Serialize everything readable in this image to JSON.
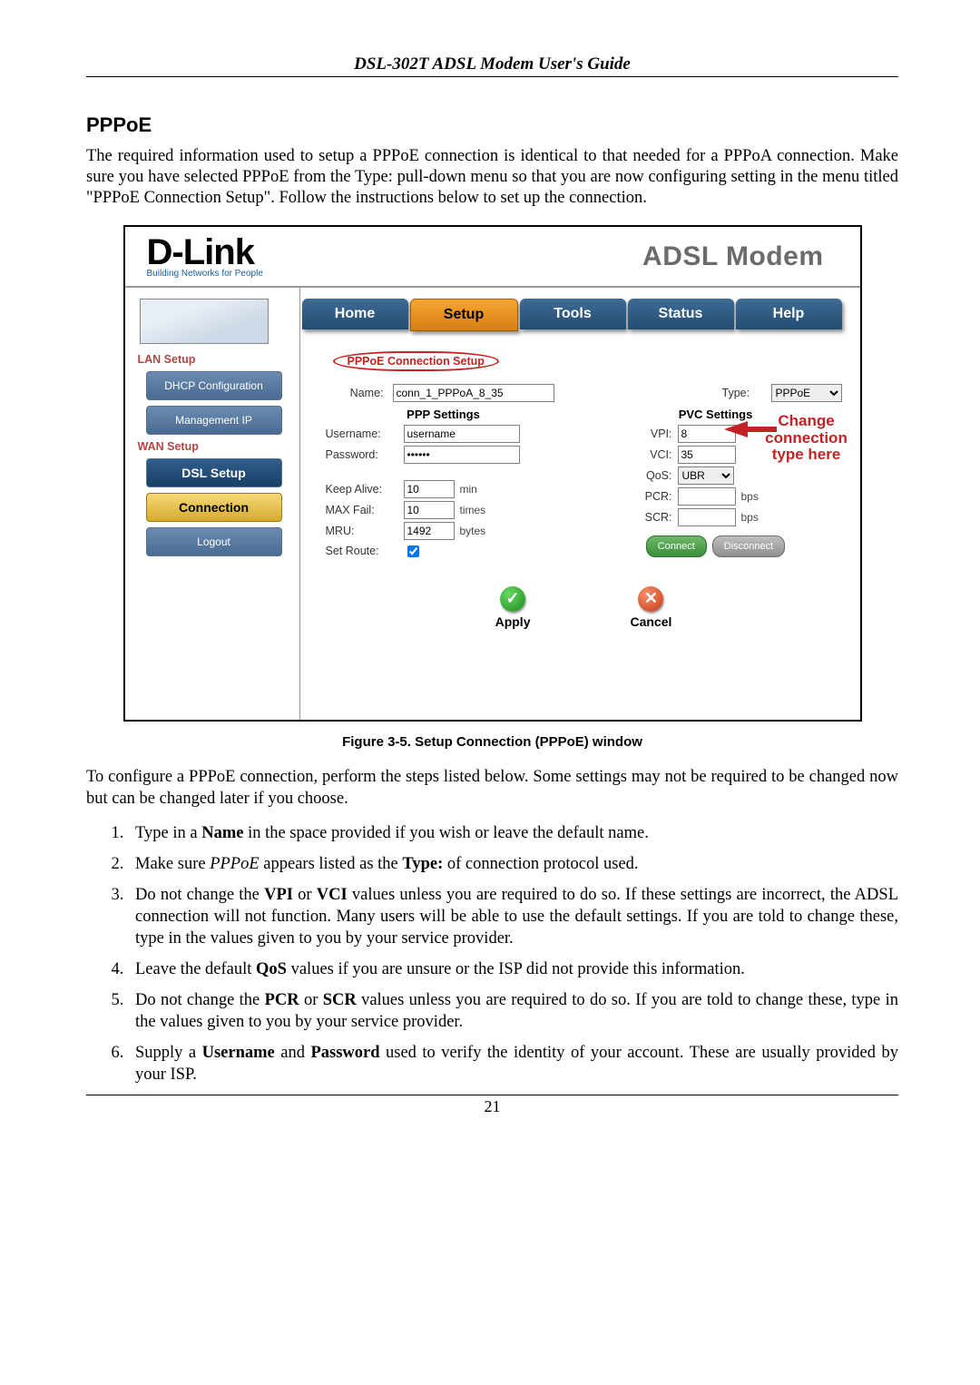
{
  "running_head": "DSL-302T ADSL Modem User's Guide",
  "section_title": "PPPoE",
  "intro": "The required information used to setup a PPPoE connection is identical to that needed for a PPPoA connection. Make sure you have selected PPPoE from the Type: pull-down menu so that you are now configuring setting in the menu titled \"PPPoE Connection Setup\". Follow the instructions below to set up the connection.",
  "brand": {
    "logo": "D-Link",
    "tagline": "Building Networks for People",
    "title": "ADSL Modem"
  },
  "tabs": {
    "home": "Home",
    "setup": "Setup",
    "tools": "Tools",
    "status": "Status",
    "help": "Help"
  },
  "sidebar": {
    "lan_title": "LAN Setup",
    "dhcp": "DHCP Configuration",
    "mgmt": "Management IP",
    "wan_title": "WAN Setup",
    "dsl": "DSL Setup",
    "connection": "Connection",
    "logout": "Logout"
  },
  "form": {
    "group_title": "PPPoE Connection Setup",
    "name_label": "Name:",
    "name_value": "conn_1_PPPoA_8_35",
    "type_label": "Type:",
    "type_value": "PPPoE",
    "callout": "Change connection type here",
    "ppp_title": "PPP Settings",
    "pvc_title": "PVC Settings",
    "username_label": "Username:",
    "username_value": "username",
    "password_label": "Password:",
    "password_value": "******",
    "keepalive_label": "Keep Alive:",
    "keepalive_value": "10",
    "keepalive_unit": "min",
    "maxfail_label": "MAX Fail:",
    "maxfail_value": "10",
    "maxfail_unit": "times",
    "mru_label": "MRU:",
    "mru_value": "1492",
    "mru_unit": "bytes",
    "setroute_label": "Set Route:",
    "vpi_label": "VPI:",
    "vpi_value": "8",
    "vci_label": "VCI:",
    "vci_value": "35",
    "qos_label": "QoS:",
    "qos_value": "UBR",
    "pcr_label": "PCR:",
    "scr_label": "SCR:",
    "bps_unit": "bps",
    "connect": "Connect",
    "disconnect": "Disconnect",
    "apply": "Apply",
    "cancel": "Cancel"
  },
  "figure_caption": "Figure 3-5. Setup Connection (PPPoE) window",
  "after_figure": "To configure a PPPoE connection, perform the steps listed below. Some settings may not be required to be changed now but can be changed later if you choose.",
  "steps": {
    "s1a": "Type in a ",
    "s1b": "Name",
    "s1c": " in the space provided if you wish or leave the default name.",
    "s2a": "Make sure ",
    "s2b": "PPPoE",
    "s2c": " appears listed as the ",
    "s2d": "Type:",
    "s2e": " of connection protocol used.",
    "s3a": "Do not change the ",
    "s3b": "VPI",
    "s3c": " or ",
    "s3d": "VCI",
    "s3e": " values unless you are required to do so. If these settings are incorrect, the ADSL connection will not function. Many users will be able to use the default settings. If you are told to change these, type in the values given to you by your service provider.",
    "s4a": "Leave the default ",
    "s4b": "QoS",
    "s4c": " values if you are unsure or the ISP did not provide this information.",
    "s5a": "Do not change the ",
    "s5b": "PCR",
    "s5c": " or ",
    "s5d": "SCR",
    "s5e": " values unless you are required to do so. If you are told to change these, type in the values given to you by your service provider.",
    "s6a": "Supply a ",
    "s6b": "Username",
    "s6c": " and ",
    "s6d": "Password",
    "s6e": " used to verify the identity of your account. These are usually provided by your ISP."
  },
  "page_number": "21"
}
